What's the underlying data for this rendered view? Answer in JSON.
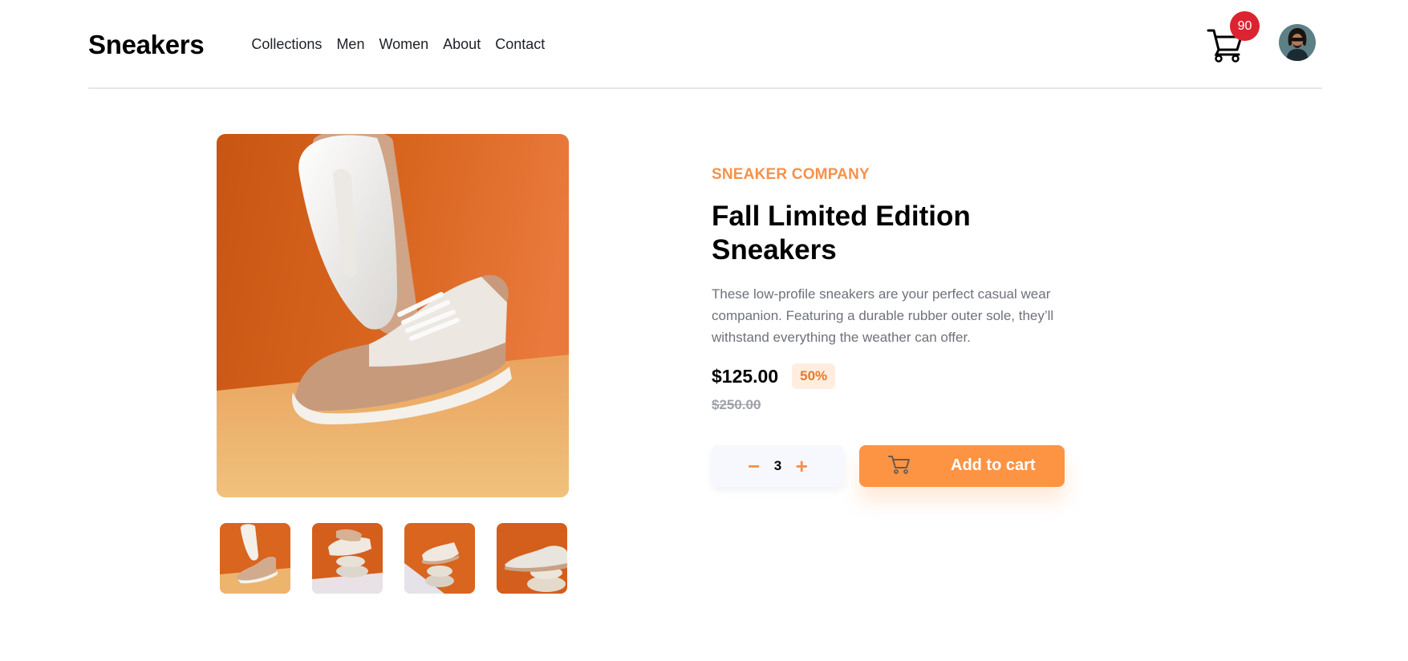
{
  "header": {
    "logo": "Sneakers",
    "nav": [
      "Collections",
      "Men",
      "Women",
      "About",
      "Contact"
    ],
    "cart_count": "90"
  },
  "product": {
    "company": "SNEAKER COMPANY",
    "title": "Fall Limited Edition Sneakers",
    "description": "These low-profile sneakers are your perfect casual wear companion. Featuring a durable rubber outer sole, they’ll withstand everything the weather can offer.",
    "price": "$125.00",
    "discount": "50%",
    "old_price": "$250.00",
    "quantity": "3",
    "qty_minus": "−",
    "qty_plus": "+",
    "add_to_cart": "Add to cart"
  },
  "colors": {
    "accent": "#fd9444",
    "badge": "#dc2430",
    "discount_bg": "#ffeee0"
  }
}
